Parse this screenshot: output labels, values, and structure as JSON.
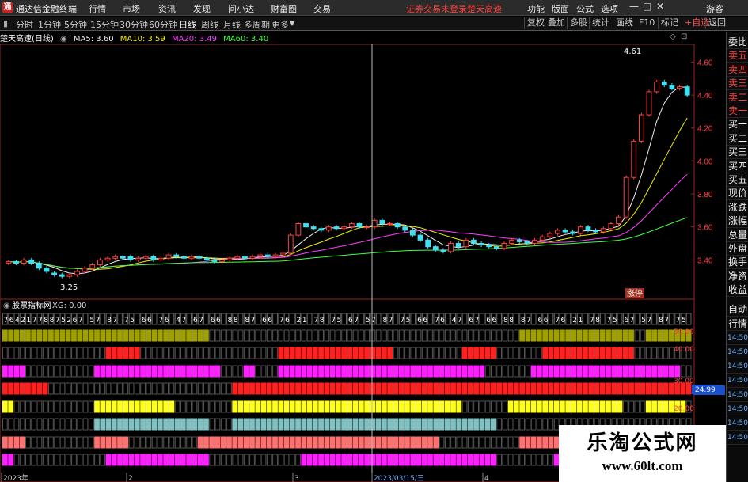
{
  "app": {
    "logo_char": "通",
    "title": "通达信金融终端",
    "status": "证券交易未登录",
    "stock_name": "楚天高速",
    "guest": "游客",
    "menu": [
      "行情",
      "市场",
      "资讯",
      "发现",
      "问小达",
      "财富圈",
      "交易"
    ],
    "right_menu": [
      "功能",
      "版面",
      "公式",
      "选项"
    ],
    "win": [
      "—",
      "□",
      "✕"
    ]
  },
  "timeframes": [
    "分时",
    "1分钟",
    "5分钟",
    "15分钟",
    "30分钟",
    "60分钟",
    "日线",
    "周线",
    "月线",
    "多周期",
    "更多"
  ],
  "active_timeframe": "日线",
  "toolbar": [
    "复权",
    "叠加",
    "多股",
    "统计",
    "画线",
    "F10",
    "标记",
    "+自选",
    "返回"
  ],
  "legend": {
    "name": "楚天高速(日线)",
    "ma5": "MA5: 3.60",
    "ma10": "MA10: 3.59",
    "ma20": "MA20: 3.49",
    "ma60": "MA60: 3.40"
  },
  "colors": {
    "up": "#ff4040",
    "down": "#40e0f0",
    "ma5": "#f0f0f0",
    "ma10": "#f0f000",
    "ma20": "#ff40ff",
    "ma60": "#40ff40",
    "row_olive": "#a0a000",
    "row_red": "#ff2020",
    "row_magenta": "#ff20ff",
    "row_yellow": "#ffff20",
    "row_teal": "#80c0c0",
    "row_salmon": "#ff7070"
  },
  "main_axis": {
    "ticks": [
      "4.60",
      "4.40",
      "4.20",
      "4.00",
      "3.80",
      "3.60",
      "3.40"
    ],
    "high_label": "4.61",
    "low_label": "3.25",
    "tag": "涨停"
  },
  "indicator": {
    "name": "股票指标网",
    "xg": "XG: 0.00",
    "ticks": [
      "50.00",
      "40.00",
      "30.00",
      "20.00"
    ],
    "current": "24.99",
    "digits": "764217788752676578876755666764476676667888876665"
  },
  "dates": [
    "2023年",
    "2",
    "3",
    "2023/03/15/三",
    "4"
  ],
  "side": [
    "委比",
    "卖五",
    "卖四",
    "卖三",
    "卖二",
    "卖一",
    "买一",
    "买二",
    "买三",
    "买四",
    "买五",
    "现价",
    "涨跌",
    "涨幅",
    "总量",
    "外盘",
    "换手",
    "净资",
    "收益"
  ],
  "side2": [
    "自动",
    "行情",
    "14:50",
    "14:50",
    "14:50",
    "14:50",
    "14:50",
    "14:50",
    "14:50",
    "14:50"
  ],
  "chart_data": {
    "type": "candlestick",
    "x": [
      1,
      2,
      3,
      4,
      5,
      6,
      7,
      8,
      9,
      10,
      11,
      12,
      13,
      14,
      15,
      16,
      17,
      18,
      19,
      20,
      21,
      22,
      23,
      24,
      25,
      26,
      27,
      28,
      29,
      30,
      31,
      32,
      33,
      34,
      35,
      36,
      37,
      38,
      39,
      40,
      41,
      42,
      43,
      44,
      45,
      46,
      47,
      48,
      49,
      50,
      51,
      52,
      53,
      54,
      55,
      56,
      57,
      58,
      59,
      60,
      61,
      62,
      63,
      64,
      65,
      66,
      67,
      68,
      69,
      70,
      71,
      72,
      73,
      74,
      75,
      76,
      77,
      78,
      79,
      80,
      81,
      82,
      83,
      84,
      85,
      86,
      87,
      88,
      89,
      90,
      91,
      92,
      93,
      94,
      95,
      96,
      97,
      98,
      99,
      100,
      101,
      102,
      103,
      104,
      105,
      106,
      107,
      108,
      109,
      110,
      111,
      112,
      113,
      114,
      115,
      116,
      117,
      118,
      119,
      120
    ],
    "open": [
      3.38,
      3.39,
      3.38,
      3.4,
      3.38,
      3.35,
      3.32,
      3.31,
      3.3,
      3.31,
      3.33,
      3.35,
      3.37,
      3.4,
      3.41,
      3.42,
      3.42,
      3.4,
      3.41,
      3.42,
      3.4,
      3.41,
      3.43,
      3.42,
      3.41,
      3.42,
      3.41,
      3.4,
      3.39,
      3.4,
      3.41,
      3.42,
      3.41,
      3.42,
      3.43,
      3.42,
      3.43,
      3.44,
      3.55,
      3.62,
      3.6,
      3.59,
      3.58,
      3.6,
      3.59,
      3.6,
      3.62,
      3.6,
      3.6,
      3.64,
      3.62,
      3.62,
      3.6,
      3.58,
      3.55,
      3.52,
      3.48,
      3.46,
      3.45,
      3.5,
      3.48,
      3.52,
      3.5,
      3.49,
      3.48,
      3.47,
      3.5,
      3.52,
      3.51,
      3.5,
      3.52,
      3.54,
      3.56,
      3.58,
      3.57,
      3.56,
      3.6,
      3.58,
      3.57,
      3.59,
      3.62,
      3.66,
      3.9,
      4.12,
      4.28,
      4.42,
      4.48,
      4.46,
      4.44,
      4.45
    ],
    "close": [
      3.39,
      3.38,
      3.4,
      3.38,
      3.35,
      3.33,
      3.31,
      3.3,
      3.31,
      3.33,
      3.35,
      3.37,
      3.4,
      3.41,
      3.42,
      3.41,
      3.4,
      3.41,
      3.42,
      3.4,
      3.41,
      3.43,
      3.42,
      3.41,
      3.42,
      3.41,
      3.4,
      3.39,
      3.4,
      3.41,
      3.42,
      3.41,
      3.42,
      3.43,
      3.42,
      3.43,
      3.44,
      3.55,
      3.62,
      3.6,
      3.59,
      3.58,
      3.6,
      3.59,
      3.6,
      3.62,
      3.6,
      3.6,
      3.64,
      3.62,
      3.62,
      3.6,
      3.58,
      3.55,
      3.52,
      3.48,
      3.46,
      3.45,
      3.5,
      3.48,
      3.52,
      3.5,
      3.49,
      3.48,
      3.47,
      3.5,
      3.52,
      3.51,
      3.5,
      3.52,
      3.54,
      3.56,
      3.58,
      3.57,
      3.56,
      3.6,
      3.58,
      3.57,
      3.59,
      3.62,
      3.66,
      3.9,
      4.12,
      4.28,
      4.42,
      4.48,
      4.46,
      4.44,
      4.45,
      4.4
    ],
    "y_ticks": [
      3.4,
      3.6,
      3.8,
      4.0,
      4.2,
      4.4,
      4.6
    ],
    "ylim": [
      3.2,
      4.65
    ]
  }
}
